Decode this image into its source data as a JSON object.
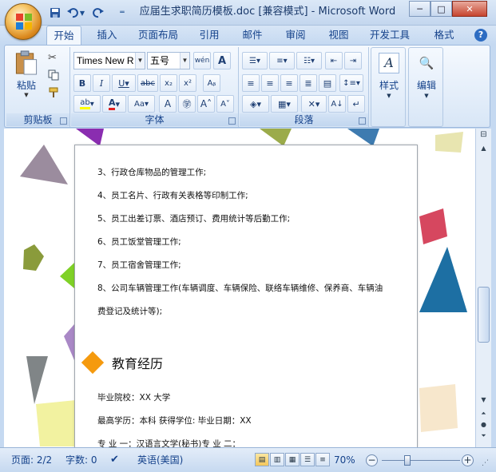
{
  "window": {
    "title": "应届生求职简历模板.doc [兼容模式] - Microsoft Word",
    "qat": {
      "save": "save-icon",
      "undo": "undo-icon",
      "redo": "redo-icon"
    },
    "buttons": {
      "minimize": "─",
      "maximize": "□",
      "close": "✕"
    }
  },
  "tabs": [
    {
      "label": "开始"
    },
    {
      "label": "插入"
    },
    {
      "label": "页面布局"
    },
    {
      "label": "引用"
    },
    {
      "label": "邮件"
    },
    {
      "label": "审阅"
    },
    {
      "label": "视图"
    },
    {
      "label": "开发工具"
    },
    {
      "label": "格式"
    }
  ],
  "ribbon": {
    "clipboard": {
      "label": "剪贴板",
      "paste": "粘贴"
    },
    "font": {
      "label": "字体",
      "name": "Times New R",
      "size": "五号"
    },
    "paragraph": {
      "label": "段落"
    },
    "styles": {
      "label": "样式"
    },
    "editing": {
      "label": "编辑"
    }
  },
  "document": {
    "lines": [
      "3、行政仓库物品的管理工作;",
      "4、员工名片、行政有关表格等印制工作;",
      "5、员工出差订票、酒店预订、费用统计等后勤工作;",
      "6、员工饭堂管理工作;",
      "7、员工宿舍管理工作;",
      "8、公司车辆管理工作(车辆调度、车辆保险、联络车辆维修、保养商、车辆油",
      "费登记及统计等);"
    ],
    "section_title": "教育经历",
    "edu": [
      "毕业院校：XX 大学",
      "最高学历：本科       获得学位:  毕业日期：XX",
      "专  业  一：汉语言文学(秘书)专  业  二："
    ]
  },
  "status": {
    "page": "页面: 2/2",
    "words": "字数: 0",
    "language": "英语(美国)",
    "zoom": "70%"
  }
}
